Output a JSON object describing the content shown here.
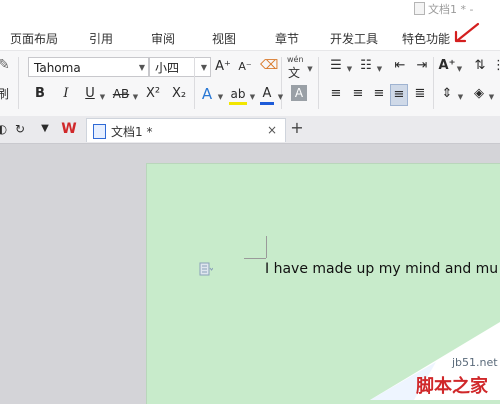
{
  "window": {
    "doc_title": "文档1 * -"
  },
  "menu": {
    "items": [
      "页面布局",
      "引用",
      "审阅",
      "视图",
      "章节",
      "开发工具",
      "特色功能"
    ]
  },
  "ribbon": {
    "font_name": "Tahoma",
    "font_size": "小四",
    "increase_font_label": "A⁺",
    "decrease_font_label": "A⁻",
    "bold": "B",
    "italic": "I",
    "underline": "U",
    "strikethrough": "AB",
    "superscript": "X²",
    "subscript": "X₂",
    "text_effect": "A",
    "highlight": "ab",
    "font_color": "A",
    "char_shading": "A",
    "pinyin_top": "wén",
    "pinyin_bottom": "文",
    "brush_label": "刷"
  },
  "tabs": {
    "active_label": "文档1 *",
    "close": "×",
    "add": "+"
  },
  "document": {
    "text": "I have made up my mind and mu"
  },
  "watermark": {
    "site": "jb51.net",
    "name": "脚本之家"
  },
  "colors": {
    "page_background": "#c8ebcb",
    "accent_red": "#d0282a",
    "highlight_yellow": "#f2e600",
    "font_color_red": "#e02020",
    "font_color_blue": "#1d5bd8"
  }
}
